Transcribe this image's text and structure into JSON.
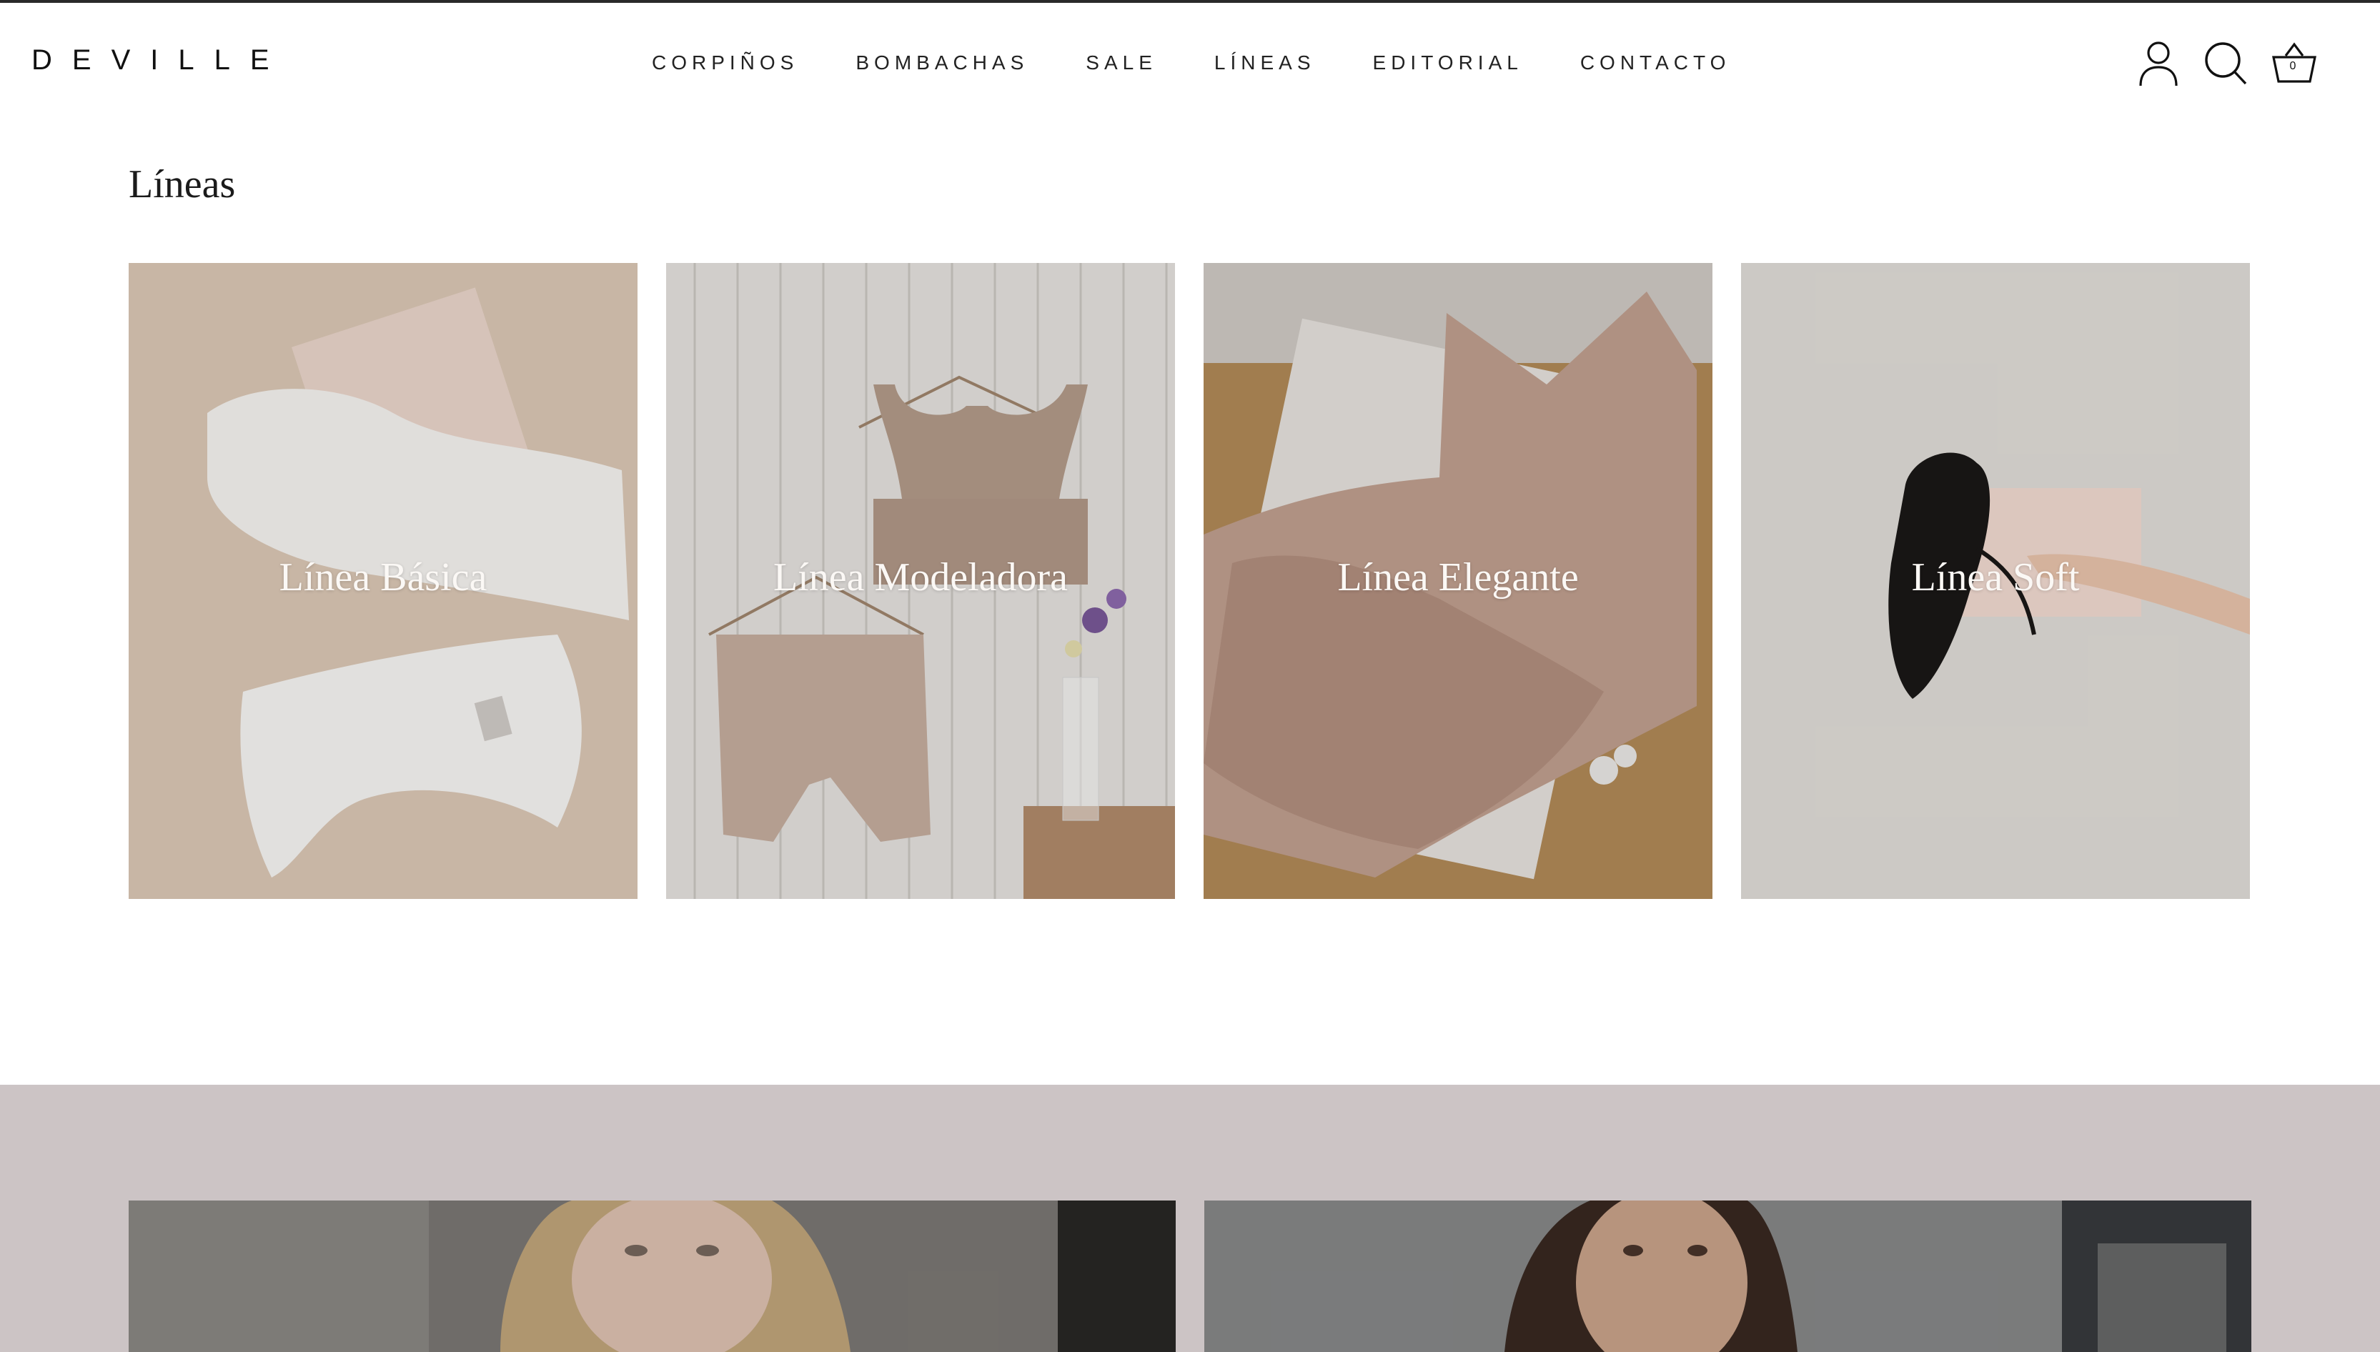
{
  "brand": {
    "logo_text": "DEVILLE"
  },
  "nav": {
    "items": [
      {
        "label": "CORPIÑOS"
      },
      {
        "label": "BOMBACHAS"
      },
      {
        "label": "SALE"
      },
      {
        "label": "LÍNEAS"
      },
      {
        "label": "EDITORIAL"
      },
      {
        "label": "CONTACTO"
      }
    ]
  },
  "header_icons": {
    "account": "user-icon",
    "search": "search-icon",
    "cart": "basket-icon",
    "cart_count": "0"
  },
  "lineas": {
    "title": "Líneas",
    "cards": [
      {
        "label": "Línea Básica"
      },
      {
        "label": "Línea Modeladora"
      },
      {
        "label": "Línea Elegante"
      },
      {
        "label": "Línea Soft"
      }
    ]
  },
  "colors": {
    "band": "#ccc4c5",
    "text": "#111111"
  }
}
